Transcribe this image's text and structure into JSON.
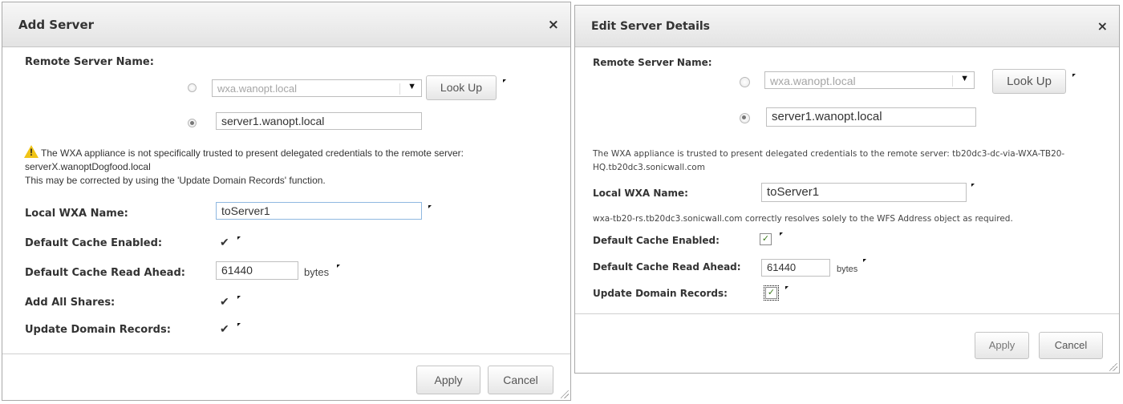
{
  "add_server": {
    "title": "Add Server",
    "close_icon": "×",
    "remote_server_label": "Remote Server Name:",
    "lookup_select_value": "wxa.wanopt.local",
    "lookup_button": "Look Up",
    "server_name_value": "server1.wanopt.local",
    "warning_line1": "The WXA appliance is not specifically trusted to present delegated credentials to the remote server:",
    "warning_line2": "serverX.wanoptDogfood.local",
    "warning_line3": "This may be corrected by using the 'Update Domain Records' function.",
    "local_wxa_label": "Local WXA Name:",
    "local_wxa_value": "toServer1",
    "default_cache_enabled_label": "Default Cache Enabled:",
    "default_cache_read_ahead_label": "Default Cache Read Ahead:",
    "read_ahead_value": "61440",
    "bytes_label": "bytes",
    "add_all_shares_label": "Add All Shares:",
    "update_domain_records_label": "Update Domain Records:",
    "check_glyph": "✔",
    "apply_button": "Apply",
    "cancel_button": "Cancel"
  },
  "edit_server": {
    "title": "Edit Server Details",
    "close_icon": "×",
    "remote_server_label": "Remote Server Name:",
    "lookup_select_value": "wxa.wanopt.local",
    "lookup_button": "Look Up",
    "server_name_value": "server1.wanopt.local",
    "trust_line1": "The WXA appliance is trusted to present delegated credentials to the remote server: tb20dc3-dc-via-WXA-TB20-",
    "trust_line2": "HQ.tb20dc3.sonicwall.com",
    "local_wxa_label": "Local WXA Name:",
    "local_wxa_value": "toServer1",
    "resolve_message": "wxa-tb20-rs.tb20dc3.sonicwall.com correctly resolves solely to the WFS Address object as required.",
    "default_cache_enabled_label": "Default Cache Enabled:",
    "default_cache_read_ahead_label": "Default Cache Read Ahead:",
    "read_ahead_value": "61440",
    "bytes_label": "bytes",
    "update_domain_records_label": "Update Domain Records:",
    "check_glyph": "✓",
    "apply_button": "Apply",
    "cancel_button": "Cancel"
  }
}
